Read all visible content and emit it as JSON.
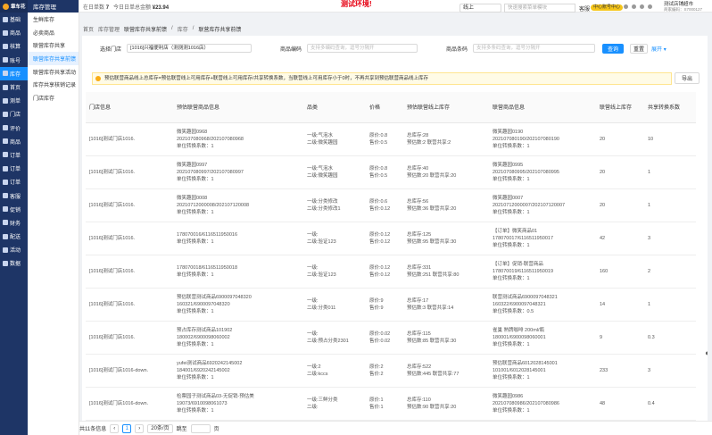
{
  "nav": {
    "logo": "章车花",
    "items": [
      "基础",
      "商品",
      "核算",
      "账号",
      "库存",
      "首页",
      "测单",
      "门店",
      "评价",
      "商品",
      "订单",
      "订单",
      "订单",
      "客服",
      "促销",
      "财务",
      "配送",
      "活动",
      "数据"
    ],
    "active_index": 4
  },
  "sub": {
    "title": "库存管理",
    "items": [
      "生鲜库存",
      "必卖商品",
      "联营库存共享",
      "联营库存共享前馈",
      "联营库存共享活动",
      "库存共享核销记录",
      "门店库存"
    ],
    "active_index": 3
  },
  "top": {
    "store_prefix": "在日单数",
    "store_count": "7",
    "today_label": "今日日单总金额",
    "today_amount": "¥23.94",
    "env": "测试环境!",
    "channel": "线上",
    "search_placeholder": "快速搜索菜单模块",
    "service": "客服",
    "center": "中心账号中心",
    "user": "测试店铺超市",
    "user_sub": "商家编码：S7000127"
  },
  "crumb": [
    "首页",
    "库存管理",
    "联营库存共享前馈",
    "库存",
    "联营库存共享前馈"
  ],
  "filter": {
    "store_label": "选择门店",
    "store_value": "[1016]兴福便利店（测测测1016店）",
    "code_label": "商品编码",
    "code_placeholder": "支持多编码查询，逗号分隔开",
    "barcode_label": "商品条码",
    "barcode_placeholder": "支持多条码查询，逗号分隔开",
    "query": "查询",
    "reset": "重置",
    "expand": "展开"
  },
  "alert": "预估联营商品线上总库存=预估联营线上可用库存+联营线上可用库存/共享转换系数，当联营线上可用库存小于0时，不再共享到预估联营商品线上库存",
  "export": "导出",
  "columns": [
    "门店信息",
    "预估联营商品信息",
    "品类",
    "价格",
    "预估联营线上库存",
    "联营商品信息",
    "联营线上库存",
    "共享转换系数"
  ],
  "rows": [
    {
      "store": "[1016]测试门店1016.",
      "product": [
        "微笑趣园0968",
        "202107080968/202107080968",
        "单位转换系数：1"
      ],
      "category": [
        "一级:气泡水",
        "二级:微笑趣园"
      ],
      "price": [
        "原价:0.8",
        "售价:0.5"
      ],
      "stock": [
        "总库存:28",
        "预估数:2 联营共享:2"
      ],
      "linked": [
        "微笑趣园0190",
        "202107080190/202107080190",
        "单位转换系数：1"
      ],
      "linked_stock": "20",
      "factor": "10"
    },
    {
      "store": "[1016]测试门店1016.",
      "product": [
        "微笑趣园0997",
        "202107080997/202107080997",
        "单位转换系数：1"
      ],
      "category": [
        "一级:气泡水",
        "二级:微笑趣园"
      ],
      "price": [
        "原价:0.8",
        "售价:0.5"
      ],
      "stock": [
        "总库存:40",
        "预估数:20 联营共享:20"
      ],
      "linked": [
        "微笑趣园0995",
        "202107080995/202107080995",
        "单位转换系数：1"
      ],
      "linked_stock": "20",
      "factor": "1"
    },
    {
      "store": "[1016]测试门店1016.",
      "product": [
        "微笑趣园0008",
        "20210712000008/202107120008",
        "单位转换系数：1"
      ],
      "category": [
        "一级:分类修改",
        "二级:分类修改1"
      ],
      "price": [
        "原价:0.6",
        "售价:0.12"
      ],
      "stock": [
        "总库存:56",
        "预估数:36 联营共享:20"
      ],
      "linked": [
        "微笑趣园0007",
        "20210712000007/202107120007",
        "单位转换系数：1"
      ],
      "linked_stock": "20",
      "factor": "1"
    },
    {
      "store": "[1016]测试门店1016.",
      "product": [
        "178070016/6116511950016",
        "单位转换系数：1"
      ],
      "category": [
        "一级:",
        "二级:验证123"
      ],
      "price": [
        "原价:0.12",
        "售价:0.12"
      ],
      "stock": [
        "总库存:125",
        "预估数:95 联营共享:30"
      ],
      "linked": [
        "【订单】微笑商品01",
        "178070017/6116511950017",
        "单位转换系数：1"
      ],
      "linked_stock": "42",
      "factor": "3"
    },
    {
      "store": "[1016]测试门店1016.",
      "product": [
        "178070018/6116511950018",
        "单位转换系数：1"
      ],
      "category": [
        "一级:",
        "二级:验证123"
      ],
      "price": [
        "原价:0.12",
        "售价:0.12"
      ],
      "stock": [
        "总库存:331",
        "预估数:251 联营共享:80"
      ],
      "linked": [
        "【订单】促销-联营商品",
        "178070019/6116511950019",
        "单位转换系数：1"
      ],
      "linked_stock": "160",
      "factor": "2"
    },
    {
      "store": "[1016]测试门店1016.",
      "product": [
        "预估联营测试商品6900097048320",
        "160321/6900097048320",
        "单位转换系数：1"
      ],
      "category": [
        "一级:",
        "二级:分类011"
      ],
      "price": [
        "原价:9",
        "售价:9"
      ],
      "stock": [
        "总库存:17",
        "预估数:3 联营共享:14"
      ],
      "linked": [
        "联营测试商品6900097048321",
        "160322/6900097048321",
        "单位转换系数：0.5"
      ],
      "linked_stock": "14",
      "factor": "1"
    },
    {
      "store": "[1016]测试门店1016.",
      "product": [
        "预占库存测试商品101902",
        "180002/6900098060002",
        "单位转换系数：1"
      ],
      "category": [
        "一级:",
        "二级:预占分类2301"
      ],
      "price": [
        "原价:0.02",
        "售价:0.02"
      ],
      "stock": [
        "总库存:115",
        "预估数:85 联营共享:30"
      ],
      "linked": [
        "雀巢 熟牌咖啡 200ml/瓶",
        "180001/6900098060001",
        "单位转换系数：1"
      ],
      "linked_stock": "9",
      "factor": "0.3"
    },
    {
      "store": "[1016]测试门店1016-down.",
      "product": [
        "yufei测试商品6920242145002",
        "184001/6920242145002",
        "单位转换系数：1"
      ],
      "category": [
        "一级:2",
        "二级:kccs"
      ],
      "price": [
        "原价:2",
        "售价:2"
      ],
      "stock": [
        "总库存:522",
        "预估数:445 联营共享:77"
      ],
      "linked": [
        "预估联营商品6012028145001",
        "101001/6012028145001",
        "单位转换系数：1"
      ],
      "linked_stock": "233",
      "factor": "3"
    },
    {
      "store": "[1016]测试门店1016-down.",
      "product": [
        "检票园子测试商品03-无促销-预估美",
        "19073/6910098061073",
        "单位转换系数：1"
      ],
      "category": [
        "一级:三鲜分类",
        "二级:"
      ],
      "price": [
        "原价:1",
        "售价:1"
      ],
      "stock": [
        "总库存:110",
        "预估数:90 联营共享:20"
      ],
      "linked": [
        "微笑趣园0986",
        "202107080986/202107080986",
        "单位转换系数：1"
      ],
      "linked_stock": "48",
      "factor": "0.4"
    }
  ],
  "pager": {
    "total": "共11条信息",
    "prev": "‹",
    "page": "1",
    "next": "›",
    "size": "20条/页",
    "goto": "跳至",
    "page_unit": "页"
  }
}
